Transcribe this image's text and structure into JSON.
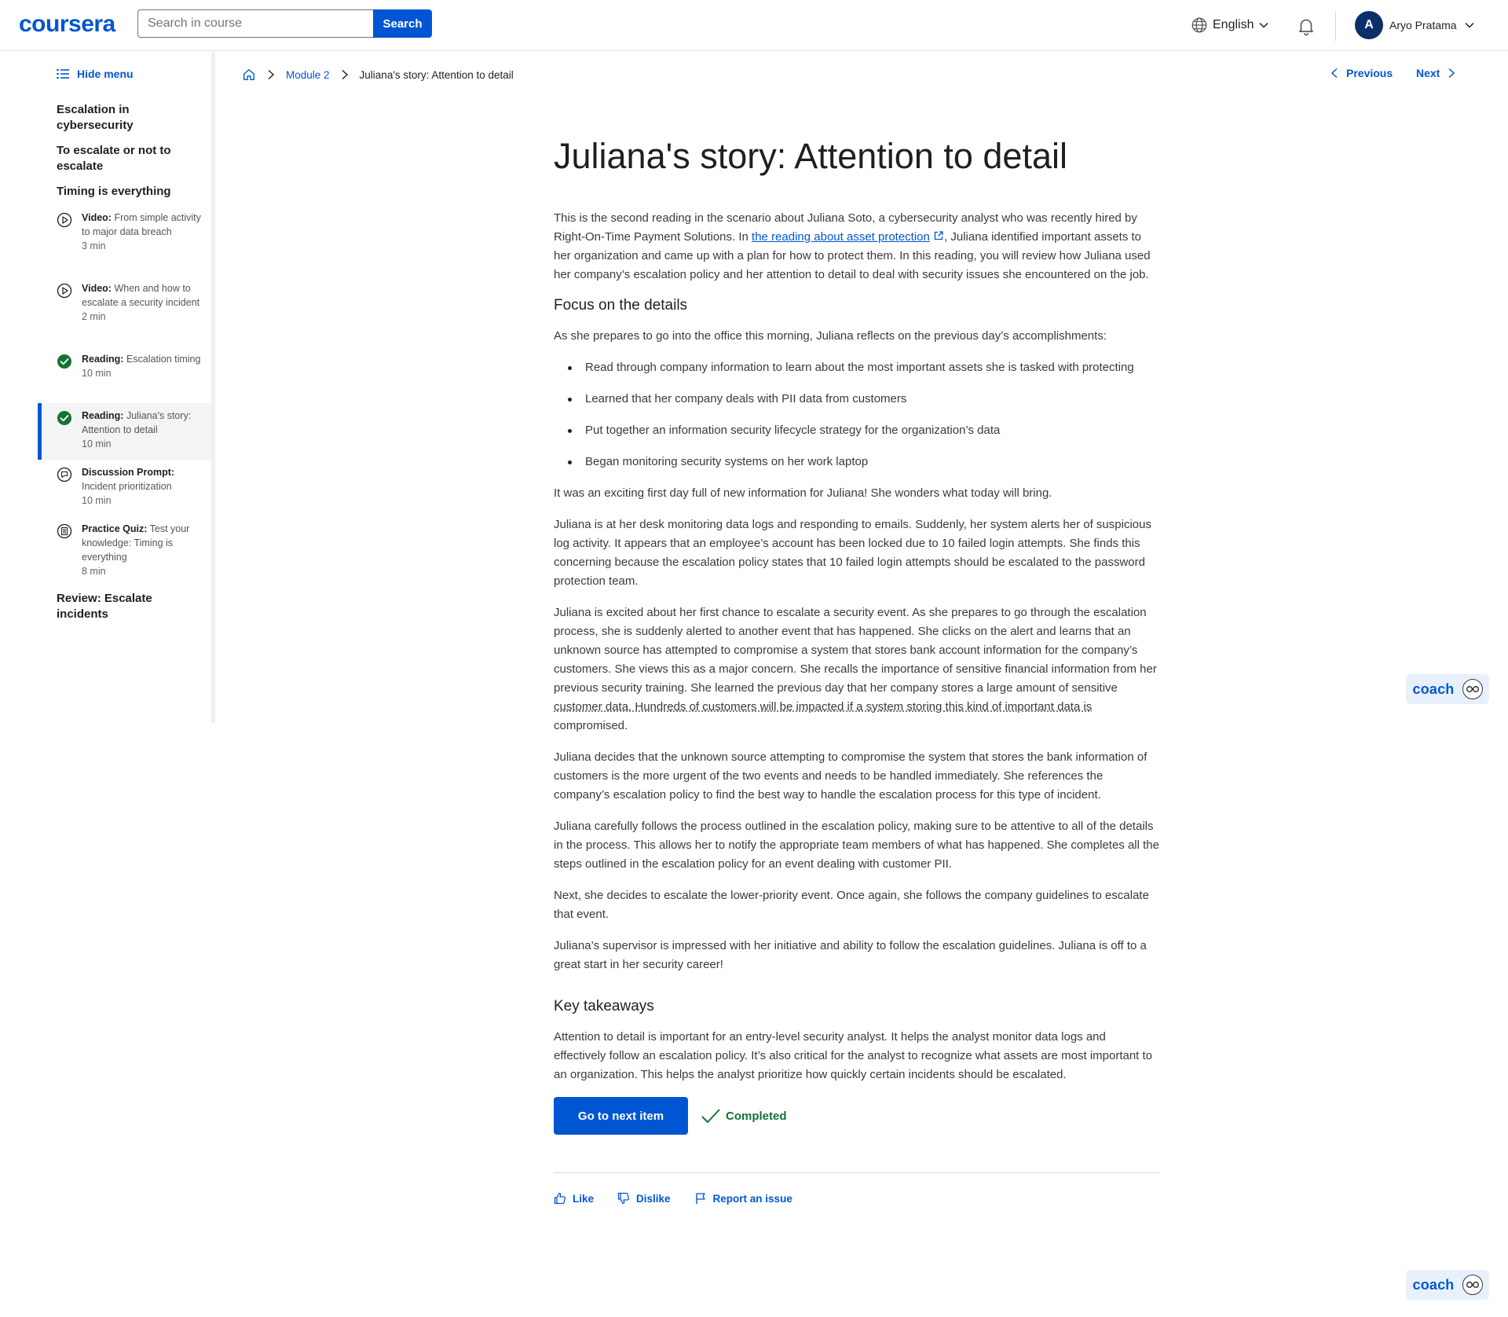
{
  "header": {
    "logo": "coursera",
    "search_placeholder": "Search in course",
    "search_button": "Search",
    "language": "English",
    "user_initial": "A",
    "user_name": "Aryo Pratama"
  },
  "sidebar": {
    "hide_menu": "Hide menu",
    "sections": [
      "Escalation in cybersecurity",
      "To escalate or not to escalate",
      "Timing is everything",
      "Review: Escalate incidents"
    ],
    "items": [
      {
        "type": "Video:",
        "title": "From simple activity to major data breach",
        "duration": "3 min",
        "icon": "play-circle-icon",
        "state": "default"
      },
      {
        "type": "Video:",
        "title": "When and how to escalate a security incident",
        "duration": "2 min",
        "icon": "play-circle-icon",
        "state": "default"
      },
      {
        "type": "Reading:",
        "title": "Escalation timing",
        "duration": "10 min",
        "icon": "check-circle-icon",
        "state": "completed"
      },
      {
        "type": "Reading:",
        "title": "Juliana's story: Attention to detail",
        "duration": "10 min",
        "icon": "check-circle-icon",
        "state": "active"
      },
      {
        "type": "Discussion Prompt:",
        "title": "Incident prioritization",
        "duration": "10 min",
        "icon": "chat-bubble-icon",
        "state": "default"
      },
      {
        "type": "Practice Quiz:",
        "title": "Test your knowledge: Timing is everything",
        "duration": "8 min",
        "icon": "quiz-icon",
        "state": "default"
      }
    ]
  },
  "breadcrumb": {
    "module": "Module 2",
    "current": "Juliana's story: Attention to detail"
  },
  "nav": {
    "previous": "Previous",
    "next": "Next"
  },
  "article": {
    "title": "Juliana's story: Attention to detail",
    "intro_before": "This is the second reading in the scenario about Juliana Soto, a cybersecurity analyst who was recently hired by Right-On-Time Payment Solutions. In ",
    "intro_link": "the reading about asset protection",
    "intro_after": ", Juliana identified important assets to her organization and came up with a plan for how to protect them. In this reading, you will review how Juliana used her company’s escalation policy and her attention to detail to deal with security issues she encountered on the job.",
    "heading_focus": "Focus on the details",
    "p_prepares": "As she prepares to go into the office this morning, Juliana reflects on the previous day’s accomplishments:",
    "bullets": [
      "Read through company information to learn about the most important assets she is tasked with protecting",
      "Learned that her company deals with PII data from customers",
      "Put together an information security lifecycle strategy for the organization’s data",
      "Began monitoring security systems on her work laptop"
    ],
    "p_exciting": "It was an exciting first day full of new information for Juliana! She wonders what today will bring.",
    "p_desk": "Juliana is at her desk monitoring data logs and responding to emails. Suddenly, her system alerts her of suspicious log activity. It appears that an employee’s account has been locked due to 10 failed login attempts. She finds this concerning because the escalation policy states that 10 failed login attempts should be escalated to the password protection team.",
    "p_excited_before": "Juliana is excited about her first chance to escalate a security event. As she prepares to go through the escalation process, she is suddenly alerted to another event that has happened. She clicks on the alert and learns that an unknown source has attempted to compromise a system that stores bank account information for the company’s customers. She views this as a major concern. She recalls the importance of sensitive financial information from her previous security training. She learned the previous day that her company stores a large amount of sensitive ",
    "p_excited_dotted": "customer data. Hundreds of customers will be impacted if a system storing this kind of important data is",
    "p_excited_after": " compromised.",
    "p_decides": "Juliana decides that the unknown source attempting to compromise the system that stores the bank information of customers is the more urgent of the two events and needs to be handled immediately. She references the company’s escalation policy to find the best way to handle the escalation process for this type of incident.",
    "p_follows": "Juliana carefully follows the process outlined in the escalation policy, making sure to be attentive to all of the details in the process. This allows her to notify the appropriate team members of what has happened. She completes all the steps outlined in the escalation policy for an event dealing with customer PII.",
    "p_next": "Next, she decides to escalate the lower-priority event. Once again, she follows the company guidelines to escalate that event.",
    "p_supervisor": "Juliana’s supervisor is impressed with her initiative and ability to follow the escalation guidelines. Juliana is off to a great start in her security career!",
    "heading_key": "Key takeaways",
    "p_key": "Attention to detail is important for an entry-level security analyst. It helps the analyst monitor data logs and effectively follow an escalation policy. It’s also critical for the analyst to recognize what assets are most important to an organization. This helps the analyst prioritize how quickly certain incidents should be escalated."
  },
  "actions": {
    "next_item": "Go to next item",
    "completed": "Completed"
  },
  "feedback": {
    "like": "Like",
    "dislike": "Dislike",
    "report": "Report an issue"
  },
  "coach": {
    "label": "coach"
  },
  "colors": {
    "primary": "#0056d2",
    "success": "#137333",
    "avatar": "#0b2f6b"
  }
}
